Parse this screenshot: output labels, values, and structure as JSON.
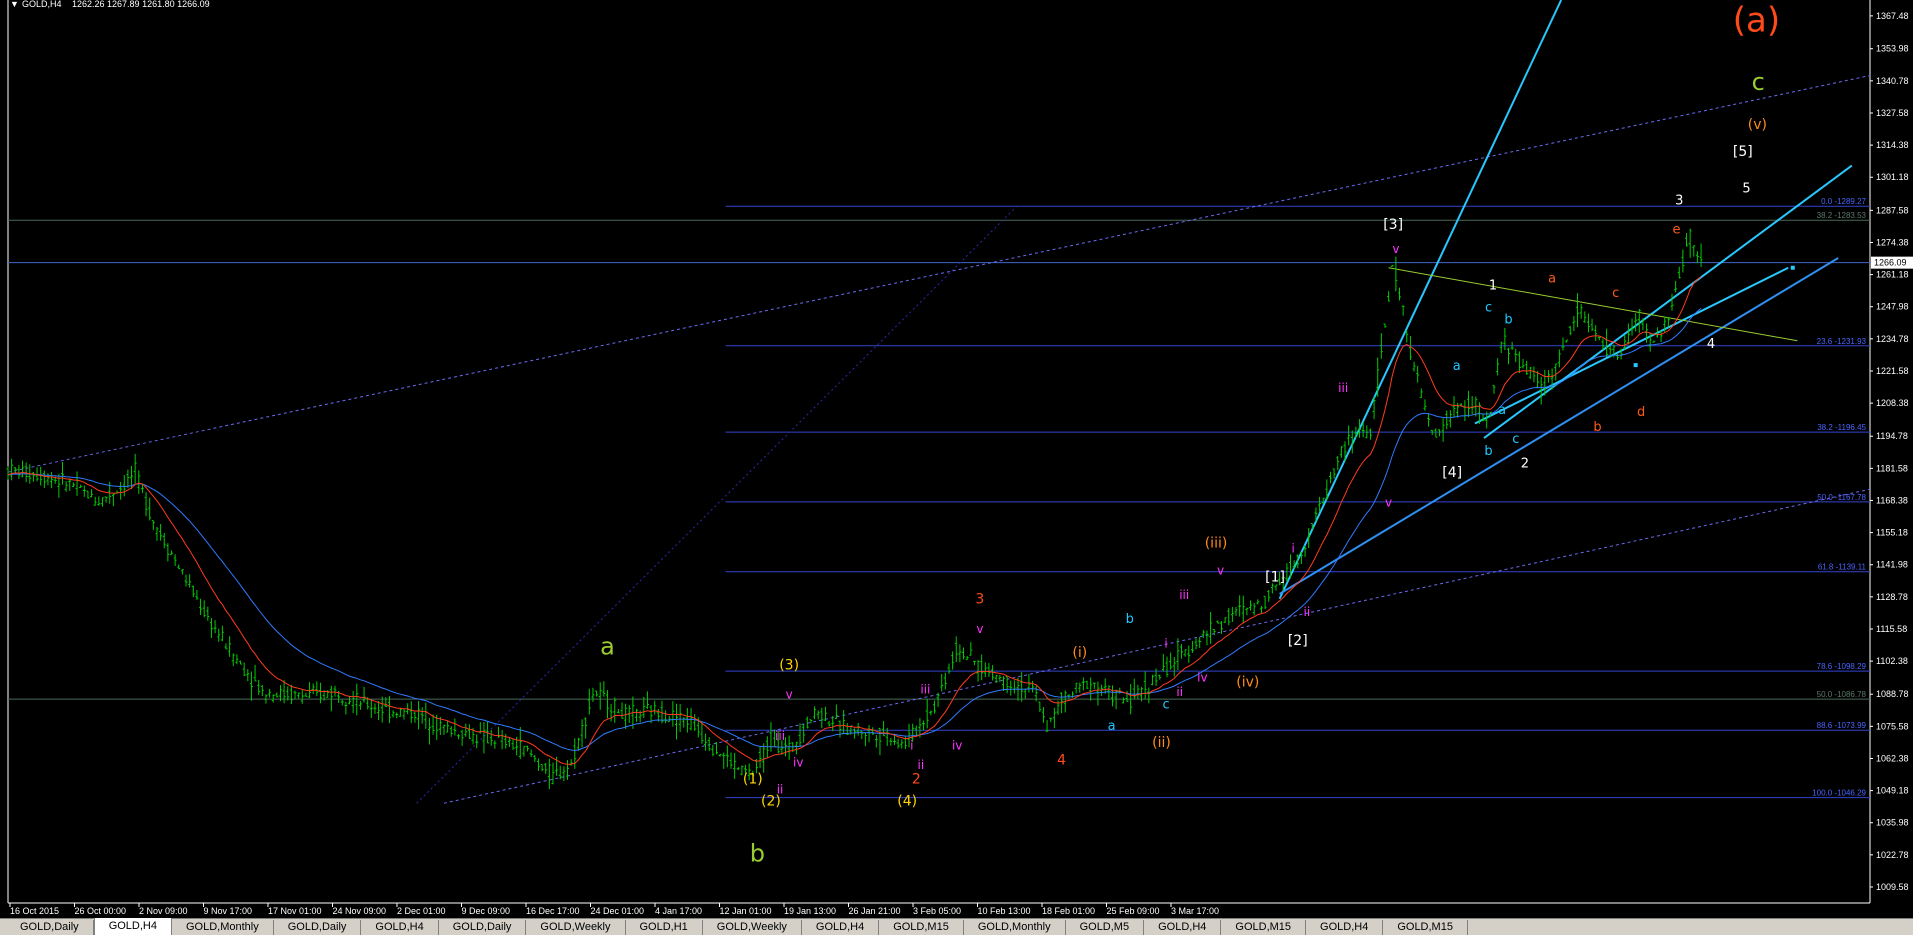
{
  "window": {
    "symbol_header": "GOLD,H4",
    "ohlc_header": "1262.26 1267.89 1261.80 1266.09"
  },
  "colors": {
    "background": "#000000",
    "candles": "#00cc00",
    "ma_fast": "#ff3b1e",
    "ma_slow": "#2f7bff",
    "fib_lines": "#3b4bd8",
    "channel": "#28c8ff",
    "axis_text": "#ffffff"
  },
  "tabs": [
    "GOLD,Daily",
    "GOLD,H4",
    "GOLD,Monthly",
    "GOLD,Daily",
    "GOLD,H4",
    "GOLD,Daily",
    "GOLD,Weekly",
    "GOLD,H1",
    "GOLD,Weekly",
    "GOLD,H4",
    "GOLD,M15",
    "GOLD,Monthly",
    "GOLD,M5",
    "GOLD,H4",
    "GOLD,M15",
    "GOLD,H4",
    "GOLD,M15"
  ],
  "active_tab": 1,
  "chart_data": {
    "type": "line",
    "symbol": "GOLD",
    "timeframe": "H4",
    "ylim": [
      1003.0,
      1374.0
    ],
    "y_ticks": [
      "1367.48",
      "1353.98",
      "1340.78",
      "1327.58",
      "1314.38",
      "1301.18",
      "1287.58",
      "1274.38",
      "1261.18",
      "1247.98",
      "1234.78",
      "1221.58",
      "1208.38",
      "1194.78",
      "1181.58",
      "1168.38",
      "1155.18",
      "1141.98",
      "1128.78",
      "1115.58",
      "1102.38",
      "1088.78",
      "1075.58",
      "1062.38",
      "1049.18",
      "1035.98",
      "1022.78",
      "1009.58"
    ],
    "current_price_label": "1266.09",
    "current_price": 1266.09,
    "x_ticks": [
      "16 Oct 2015",
      "26 Oct 00:00",
      "2 Nov 09:00",
      "9 Nov 17:00",
      "17 Nov 01:00",
      "24 Nov 09:00",
      "2 Dec 01:00",
      "9 Dec 09:00",
      "16 Dec 17:00",
      "24 Dec 01:00",
      "4 Jan 17:00",
      "12 Jan 01:00",
      "19 Jan 13:00",
      "26 Jan 21:00",
      "3 Feb 05:00",
      "10 Feb 13:00",
      "18 Feb 01:00",
      "25 Feb 09:00",
      "3 Mar 17:00"
    ],
    "x_values": [
      0,
      0.04,
      0.08,
      0.12,
      0.16,
      0.2,
      0.24,
      0.28,
      0.32,
      0.36,
      0.4,
      0.44,
      0.48,
      0.52,
      0.56,
      0.6,
      0.64,
      0.68,
      0.72,
      0.76,
      0.8,
      0.84,
      0.88,
      0.92,
      0.96,
      1.0,
      1.04,
      1.08,
      1.12,
      1.16,
      1.2,
      1.24,
      1.28,
      1.32,
      1.36,
      1.4,
      1.44,
      1.48,
      1.52,
      1.56,
      1.6,
      1.64,
      1.68,
      1.72,
      1.76,
      1.8,
      1.84,
      1.88,
      1.92,
      1.96,
      2.0,
      2.04,
      2.08,
      2.12,
      2.16,
      2.2,
      2.24,
      2.28,
      2.32,
      2.36,
      2.4,
      2.44,
      2.48,
      2.52,
      2.56,
      2.6,
      2.64,
      2.68,
      2.72,
      2.76,
      2.8,
      2.84,
      2.88,
      2.92,
      2.96,
      3.0,
      3.04,
      3.08,
      3.12,
      3.16,
      3.2,
      3.24,
      3.28,
      3.32,
      3.36,
      3.4,
      3.44,
      3.48,
      3.52,
      3.56,
      3.6,
      3.64,
      3.68,
      3.72,
      3.76,
      3.8,
      3.84,
      3.88,
      3.92,
      3.96,
      4.0,
      4.04,
      4.08,
      4.12,
      4.16,
      4.2,
      4.24,
      4.28,
      4.32,
      4.36,
      4.4,
      4.44,
      4.48,
      4.52,
      4.56,
      4.6,
      4.64,
      4.68,
      4.72,
      4.76,
      4.8,
      4.84,
      4.88,
      4.92,
      4.96,
      5.0,
      5.04,
      5.08,
      5.12,
      5.16,
      5.2,
      5.24,
      5.28,
      5.32,
      5.36,
      5.4,
      5.44,
      5.48,
      5.52,
      5.56,
      5.6,
      5.64,
      5.68,
      5.72,
      5.76,
      5.8,
      5.84,
      5.88,
      5.92,
      5.96,
      6.0,
      6.04,
      6.08,
      6.12,
      6.16,
      6.2,
      6.24,
      6.28,
      6.32,
      6.36,
      6.4,
      6.44,
      6.48,
      6.52,
      6.56,
      6.6,
      6.64,
      6.68,
      6.72,
      6.76,
      6.8,
      6.84,
      6.88,
      6.92,
      6.96,
      7.0,
      7.04,
      7.08,
      7.12,
      7.16,
      7.2,
      7.24,
      7.28,
      7.32,
      7.36,
      7.4,
      7.44,
      7.48,
      7.52,
      7.56,
      7.6,
      7.64,
      7.68,
      7.72,
      7.76,
      7.8,
      7.84,
      7.88,
      7.92,
      7.96,
      8.0,
      8.04,
      8.08,
      8.12,
      8.16,
      8.2,
      8.24,
      8.28,
      8.32,
      8.36,
      8.4,
      8.44,
      8.48,
      8.52,
      8.56,
      8.6,
      8.64,
      8.68,
      8.72,
      8.76,
      8.8,
      8.84,
      8.88,
      8.92,
      8.96,
      9.0,
      9.04,
      9.08,
      9.12,
      9.16,
      9.2,
      9.24,
      9.28,
      9.32,
      9.36,
      9.4,
      9.44,
      9.48,
      9.52,
      9.56,
      9.6,
      9.64,
      9.68,
      9.72,
      9.76,
      9.8,
      9.84,
      9.88,
      9.92,
      9.96,
      10.0,
      10.04,
      10.08,
      10.12,
      10.16,
      10.2,
      10.24,
      10.28,
      10.32,
      10.36,
      10.4,
      10.44,
      10.48,
      10.52,
      10.56,
      10.6,
      10.64,
      10.68,
      10.72,
      10.76,
      10.8,
      10.84,
      10.88,
      10.92,
      10.96,
      11.0,
      11.04,
      11.08,
      11.12,
      11.16,
      11.2,
      11.24,
      11.28,
      11.32,
      11.36,
      11.4,
      11.44,
      11.48,
      11.52,
      11.56,
      11.6,
      11.64,
      11.68,
      11.72,
      11.76,
      11.8,
      11.84,
      11.88,
      11.92,
      11.96,
      12.0,
      12.04,
      12.08,
      12.12,
      12.16,
      12.2,
      12.24,
      12.28,
      12.32,
      12.36,
      12.4,
      12.44,
      12.48,
      12.52,
      12.56,
      12.6,
      12.64,
      12.68,
      12.72,
      12.76,
      12.8,
      12.84,
      12.88,
      12.92,
      12.96,
      13.0,
      13.04,
      13.08,
      13.12,
      13.16,
      13.2,
      13.24,
      13.28,
      13.32,
      13.36,
      13.4,
      13.44,
      13.48,
      13.52,
      13.56,
      13.6,
      13.64,
      13.68,
      13.72,
      13.76,
      13.8,
      13.84,
      13.88,
      13.92,
      13.96,
      14.0,
      14.04,
      14.08,
      14.12,
      14.16,
      14.2,
      14.24,
      14.28,
      14.32,
      14.36,
      14.4,
      14.44,
      14.48,
      14.52,
      14.56,
      14.6,
      14.64,
      14.68,
      14.72,
      14.76,
      14.8,
      14.84,
      14.88,
      14.92,
      14.96,
      15.0,
      15.04,
      15.08,
      15.12,
      15.16,
      15.2,
      15.24,
      15.28,
      15.32,
      15.36,
      15.4,
      15.44,
      15.48,
      15.52,
      15.56,
      15.6,
      15.64,
      15.68,
      15.72,
      15.76,
      15.8,
      15.84,
      15.88,
      15.92,
      15.96,
      16.0,
      16.04,
      16.08,
      16.12,
      16.16,
      16.2,
      16.24,
      16.28,
      16.32,
      16.36,
      16.4,
      16.44,
      16.48,
      16.52,
      16.56,
      16.6,
      16.64,
      16.68,
      16.72,
      16.76,
      16.8,
      16.84,
      16.88,
      16.92,
      16.96,
      17.0,
      17.04,
      17.08,
      17.12,
      17.16,
      17.2,
      17.24,
      17.28,
      17.32,
      17.36,
      17.4,
      17.44,
      17.48,
      17.52,
      17.56,
      17.6,
      17.64,
      17.68,
      17.72,
      17.76,
      17.8,
      17.84,
      17.88,
      17.92,
      17.96,
      18.0,
      18.04,
      18.08,
      18.12,
      18.16,
      18.2,
      18.24,
      18.28,
      18.32,
      18.36,
      18.4,
      18.44,
      18.48,
      18.52,
      18.56,
      18.6,
      18.64
    ],
    "price_path": [
      [
        0,
        1181
      ],
      [
        0.35,
        1179
      ],
      [
        0.7,
        1175
      ],
      [
        1.0,
        1168
      ],
      [
        1.25,
        1174
      ],
      [
        1.4,
        1180
      ],
      [
        1.6,
        1160
      ],
      [
        1.9,
        1140
      ],
      [
        2.2,
        1120
      ],
      [
        2.5,
        1104
      ],
      [
        2.8,
        1090
      ],
      [
        3.0,
        1089
      ],
      [
        3.3,
        1088
      ],
      [
        3.6,
        1090
      ],
      [
        3.9,
        1085
      ],
      [
        4.2,
        1082
      ],
      [
        4.5,
        1081
      ],
      [
        4.8,
        1075
      ],
      [
        5.1,
        1072
      ],
      [
        5.4,
        1070
      ],
      [
        5.7,
        1066
      ],
      [
        6.0,
        1055
      ],
      [
        6.2,
        1060
      ],
      [
        6.45,
        1090
      ],
      [
        6.8,
        1080
      ],
      [
        7.1,
        1082
      ],
      [
        7.5,
        1078
      ],
      [
        7.8,
        1066
      ],
      [
        8.05,
        1058
      ],
      [
        8.2,
        1056
      ],
      [
        8.4,
        1070
      ],
      [
        8.6,
        1066
      ],
      [
        8.9,
        1082
      ],
      [
        9.2,
        1075
      ],
      [
        9.5,
        1073
      ],
      [
        9.7,
        1072
      ],
      [
        9.85,
        1068
      ],
      [
        10.0,
        1074
      ],
      [
        10.2,
        1084
      ],
      [
        10.45,
        1108
      ],
      [
        10.7,
        1100
      ],
      [
        11.0,
        1094
      ],
      [
        11.3,
        1090
      ],
      [
        11.45,
        1075
      ],
      [
        11.6,
        1086
      ],
      [
        11.9,
        1094
      ],
      [
        12.2,
        1088
      ],
      [
        12.35,
        1086
      ],
      [
        12.6,
        1094
      ],
      [
        12.9,
        1104
      ],
      [
        13.2,
        1114
      ],
      [
        13.5,
        1122
      ],
      [
        13.8,
        1126
      ],
      [
        14.0,
        1136
      ],
      [
        14.2,
        1144
      ],
      [
        14.45,
        1166
      ],
      [
        14.7,
        1190
      ],
      [
        14.9,
        1198
      ],
      [
        15.0,
        1196
      ],
      [
        15.25,
        1266
      ],
      [
        15.5,
        1220
      ],
      [
        15.7,
        1193
      ],
      [
        15.9,
        1205
      ],
      [
        16.15,
        1208
      ],
      [
        16.3,
        1199
      ],
      [
        16.45,
        1235
      ],
      [
        16.65,
        1225
      ],
      [
        16.9,
        1215
      ],
      [
        17.1,
        1228
      ],
      [
        17.3,
        1248
      ],
      [
        17.55,
        1232
      ],
      [
        17.75,
        1228
      ],
      [
        17.95,
        1245
      ],
      [
        18.1,
        1232
      ],
      [
        18.3,
        1244
      ],
      [
        18.5,
        1278
      ],
      [
        18.64,
        1266
      ]
    ],
    "fib_levels": [
      {
        "label": "0.0 -1289.27",
        "value": 1289.27
      },
      {
        "label": "38.2 -1283.53",
        "value": 1283.53
      },
      {
        "label": "23.6 -1231.93",
        "value": 1231.93
      },
      {
        "label": "38.2 -1196.45",
        "value": 1196.45
      },
      {
        "label": "50.0 -1167.78",
        "value": 1167.78
      },
      {
        "label": "61.8 -1139.11",
        "value": 1139.11
      },
      {
        "label": "78.6 -1098.29",
        "value": 1098.29
      },
      {
        "label": "50.0 -1086.78",
        "value": 1086.78
      },
      {
        "label": "88.6 -1073.99",
        "value": 1073.99
      },
      {
        "label": "100.0 -1046.29",
        "value": 1046.29
      }
    ],
    "wave_labels": [
      {
        "text": "(a)",
        "x": 19.25,
        "y": 1361,
        "color": "#ff4a1a",
        "size": 34
      },
      {
        "text": "c",
        "x": 19.27,
        "y": 1337,
        "color": "#9acd32",
        "size": 24
      },
      {
        "text": "(v)",
        "x": 19.26,
        "y": 1321,
        "color": "#ff8c1a",
        "size": 14
      },
      {
        "text": "[5]",
        "x": 19.1,
        "y": 1310,
        "color": "#ffffff",
        "size": 14
      },
      {
        "text": "5",
        "x": 19.14,
        "y": 1295,
        "color": "#ffffff",
        "size": 13
      },
      {
        "text": "3",
        "x": 18.4,
        "y": 1290,
        "color": "#ffffff",
        "size": 13
      },
      {
        "text": "e",
        "x": 18.37,
        "y": 1278,
        "color": "#ff5a1a",
        "size": 13
      },
      {
        "text": "[3]",
        "x": 15.25,
        "y": 1280,
        "color": "#ffffff",
        "size": 14
      },
      {
        "text": "v",
        "x": 15.28,
        "y": 1270,
        "color": "#ff33ff",
        "size": 12
      },
      {
        "text": "1",
        "x": 16.35,
        "y": 1255,
        "color": "#ffffff",
        "size": 13
      },
      {
        "text": "a",
        "x": 17.0,
        "y": 1258,
        "color": "#ff5a1a",
        "size": 13
      },
      {
        "text": "c",
        "x": 17.7,
        "y": 1252,
        "color": "#ff5a1a",
        "size": 13
      },
      {
        "text": "c",
        "x": 16.3,
        "y": 1246,
        "color": "#1ec8ff",
        "size": 13
      },
      {
        "text": "b",
        "x": 16.52,
        "y": 1241,
        "color": "#1ec8ff",
        "size": 13
      },
      {
        "text": "4",
        "x": 18.75,
        "y": 1231,
        "color": "#ffffff",
        "size": 13
      },
      {
        "text": "iii",
        "x": 14.7,
        "y": 1213,
        "color": "#ff33ff",
        "size": 12
      },
      {
        "text": "a",
        "x": 15.95,
        "y": 1222,
        "color": "#1ec8ff",
        "size": 13
      },
      {
        "text": "a",
        "x": 16.45,
        "y": 1204,
        "color": "#1ec8ff",
        "size": 13
      },
      {
        "text": "d",
        "x": 17.98,
        "y": 1203,
        "color": "#ff5a1a",
        "size": 13
      },
      {
        "text": "b",
        "x": 17.5,
        "y": 1197,
        "color": "#ff5a1a",
        "size": 13
      },
      {
        "text": "c",
        "x": 16.6,
        "y": 1192,
        "color": "#1ec8ff",
        "size": 13
      },
      {
        "text": "b",
        "x": 16.3,
        "y": 1187,
        "color": "#1ec8ff",
        "size": 13
      },
      {
        "text": "2",
        "x": 16.7,
        "y": 1182,
        "color": "#ffffff",
        "size": 13
      },
      {
        "text": "[4]",
        "x": 15.9,
        "y": 1178,
        "color": "#ffffff",
        "size": 14
      },
      {
        "text": "v",
        "x": 15.2,
        "y": 1166,
        "color": "#ff33ff",
        "size": 12
      },
      {
        "text": "i",
        "x": 14.15,
        "y": 1147,
        "color": "#ff33ff",
        "size": 12
      },
      {
        "text": "[1]",
        "x": 13.95,
        "y": 1135,
        "color": "#ffffff",
        "size": 14
      },
      {
        "text": "(iii)",
        "x": 13.3,
        "y": 1149,
        "color": "#ff8c1a",
        "size": 14
      },
      {
        "text": "v",
        "x": 13.35,
        "y": 1138,
        "color": "#ff33ff",
        "size": 12
      },
      {
        "text": "iii",
        "x": 12.95,
        "y": 1128,
        "color": "#ff33ff",
        "size": 12
      },
      {
        "text": "b",
        "x": 12.35,
        "y": 1118,
        "color": "#1ec8ff",
        "size": 13
      },
      {
        "text": "ii",
        "x": 14.3,
        "y": 1121,
        "color": "#ff33ff",
        "size": 12
      },
      {
        "text": "[2]",
        "x": 14.2,
        "y": 1109,
        "color": "#ffffff",
        "size": 14
      },
      {
        "text": "i",
        "x": 12.75,
        "y": 1108,
        "color": "#ff33ff",
        "size": 12
      },
      {
        "text": "3",
        "x": 10.7,
        "y": 1126,
        "color": "#ff4a1a",
        "size": 14
      },
      {
        "text": "v",
        "x": 10.7,
        "y": 1114,
        "color": "#ff33ff",
        "size": 12
      },
      {
        "text": "(i)",
        "x": 11.8,
        "y": 1104,
        "color": "#ff8c1a",
        "size": 14
      },
      {
        "text": "(iv)",
        "x": 13.65,
        "y": 1092,
        "color": "#ff8c1a",
        "size": 14
      },
      {
        "text": "iv",
        "x": 13.15,
        "y": 1094,
        "color": "#ff33ff",
        "size": 12
      },
      {
        "text": "ii",
        "x": 12.9,
        "y": 1088,
        "color": "#ff33ff",
        "size": 12
      },
      {
        "text": "c",
        "x": 12.75,
        "y": 1083,
        "color": "#1ec8ff",
        "size": 13
      },
      {
        "text": "a",
        "x": 12.15,
        "y": 1074,
        "color": "#1ec8ff",
        "size": 13
      },
      {
        "text": "(ii)",
        "x": 12.7,
        "y": 1067,
        "color": "#ff8c1a",
        "size": 14
      },
      {
        "text": "iii",
        "x": 10.1,
        "y": 1089,
        "color": "#ff33ff",
        "size": 12
      },
      {
        "text": "4",
        "x": 11.6,
        "y": 1060,
        "color": "#ff4a1a",
        "size": 14
      },
      {
        "text": "(3)",
        "x": 8.6,
        "y": 1099,
        "color": "#ffd400",
        "size": 14
      },
      {
        "text": "v",
        "x": 8.6,
        "y": 1087,
        "color": "#ff33ff",
        "size": 12
      },
      {
        "text": "a",
        "x": 6.6,
        "y": 1105,
        "color": "#9acd32",
        "size": 24
      },
      {
        "text": "iii",
        "x": 8.5,
        "y": 1070,
        "color": "#ff33ff",
        "size": 12
      },
      {
        "text": "iv",
        "x": 8.7,
        "y": 1059,
        "color": "#ff33ff",
        "size": 12
      },
      {
        "text": "i",
        "x": 9.95,
        "y": 1066,
        "color": "#ff33ff",
        "size": 12
      },
      {
        "text": "iv",
        "x": 10.45,
        "y": 1066,
        "color": "#ff33ff",
        "size": 12
      },
      {
        "text": "ii",
        "x": 10.05,
        "y": 1058,
        "color": "#ff33ff",
        "size": 12
      },
      {
        "text": "2",
        "x": 10.0,
        "y": 1052,
        "color": "#ff4a1a",
        "size": 14
      },
      {
        "text": "(1)",
        "x": 8.2,
        "y": 1052,
        "color": "#ffd400",
        "size": 14
      },
      {
        "text": "ii",
        "x": 8.5,
        "y": 1048,
        "color": "#ff33ff",
        "size": 12
      },
      {
        "text": "(2)",
        "x": 8.4,
        "y": 1043,
        "color": "#ffd400",
        "size": 14
      },
      {
        "text": "(4)",
        "x": 9.9,
        "y": 1043,
        "color": "#ffd400",
        "size": 14
      },
      {
        "text": "b",
        "x": 8.25,
        "y": 1020,
        "color": "#9acd32",
        "size": 24
      }
    ]
  }
}
